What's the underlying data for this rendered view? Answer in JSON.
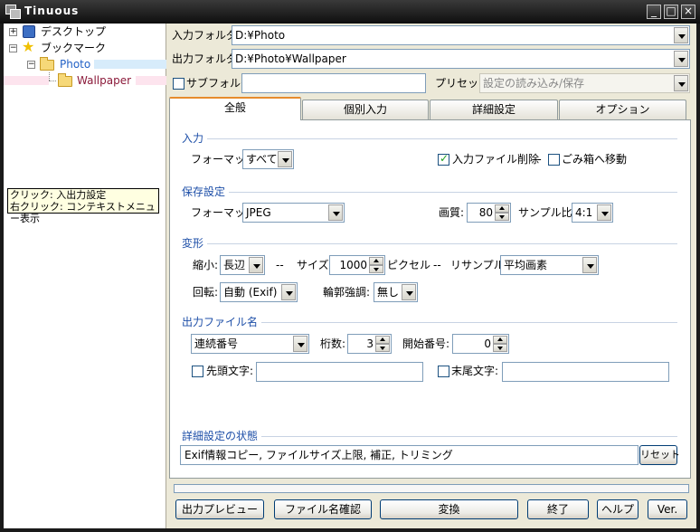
{
  "window": {
    "title": "Tinuous",
    "controls": [
      "_",
      "□",
      "×"
    ]
  },
  "tree": {
    "items": [
      {
        "label": "デスクトップ"
      },
      {
        "label": "ブックマーク"
      },
      {
        "label": "Photo"
      },
      {
        "label": "Wallpaper"
      }
    ],
    "tooltip": [
      "クリック: 入出力設定",
      "右クリック: コンテキストメニュー表示"
    ]
  },
  "io": {
    "input_label": "入力フォルダ:",
    "input_value": "D:¥Photo",
    "output_label": "出力フォルダ:",
    "output_value": "D:¥Photo¥Wallpaper",
    "subfolder_label": "サブフォルダ:",
    "subfolder_value": "",
    "preset_label": "プリセット:",
    "preset_value": "設定の読み込み/保存"
  },
  "tabs": [
    {
      "label": "全般"
    },
    {
      "label": "個別入力"
    },
    {
      "label": "詳細設定"
    },
    {
      "label": "オプション"
    }
  ],
  "input_group": {
    "title": "入力",
    "format_label": "フォーマット:",
    "format_value": "すべて",
    "delete_label": "入力ファイル削除",
    "sep": "--",
    "trash_label": "ごみ箱へ移動"
  },
  "save_group": {
    "title": "保存設定",
    "format_label": "フォーマット:",
    "format_value": "JPEG",
    "quality_label": "画質:",
    "quality_value": "80",
    "sample_label": "サンプル比:",
    "sample_value": "4:1"
  },
  "transform_group": {
    "title": "変形",
    "shrink_label": "縮小:",
    "shrink_value": "長辺",
    "sep1": "--",
    "size_label": "サイズ:",
    "size_value": "1000",
    "pixel_label": "ピクセル",
    "sep2": "--",
    "resample_label": "リサンプル:",
    "resample_value": "平均画素",
    "rotate_label": "回転:",
    "rotate_value": "自動 (Exif)",
    "edge_label": "輪郭強調:",
    "edge_value": "無し"
  },
  "filename_group": {
    "title": "出力ファイル名",
    "mode_value": "連続番号",
    "digits_label": "桁数:",
    "digits_value": "3",
    "start_label": "開始番号:",
    "start_value": "0",
    "prefix_label": "先頭文字:",
    "prefix_value": "",
    "suffix_label": "末尾文字:",
    "suffix_value": ""
  },
  "status_group": {
    "title": "詳細設定の状態",
    "value": "Exif情報コピー, ファイルサイズ上限, 補正, トリミング",
    "reset_label": "リセット"
  },
  "buttons": {
    "preview": "出力プレビュー",
    "check_names": "ファイル名確認",
    "convert": "変換",
    "exit": "終了",
    "help": "ヘルプ",
    "ver": "Ver."
  }
}
